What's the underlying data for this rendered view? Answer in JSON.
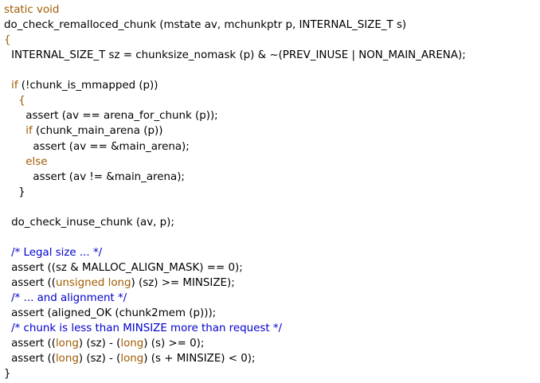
{
  "colors": {
    "text": "#000000",
    "keyword": "#a05a00",
    "comment": "#0000cc",
    "background": "#ffffff"
  },
  "lines": [
    {
      "indent": "",
      "tokens": [
        {
          "text": "static void",
          "type": "keyword"
        }
      ]
    },
    {
      "indent": "",
      "tokens": [
        {
          "text": "do_check_remalloced_chunk (mstate av, mchunkptr p, INTERNAL_SIZE_T s)",
          "type": "plain"
        }
      ]
    },
    {
      "indent": "",
      "tokens": [
        {
          "text": "{",
          "type": "keyword"
        }
      ]
    },
    {
      "indent": "  ",
      "tokens": [
        {
          "text": "INTERNAL_SIZE_T sz = chunksize_nomask (p) & ~(PREV_INUSE | NON_MAIN_ARENA);",
          "type": "plain"
        }
      ]
    },
    {
      "indent": "",
      "tokens": []
    },
    {
      "indent": "  ",
      "tokens": [
        {
          "text": "if",
          "type": "keyword"
        },
        {
          "text": " (!chunk_is_mmapped (p))",
          "type": "plain"
        }
      ]
    },
    {
      "indent": "    ",
      "tokens": [
        {
          "text": "{",
          "type": "keyword"
        }
      ]
    },
    {
      "indent": "      ",
      "tokens": [
        {
          "text": "assert (av == arena_for_chunk (p));",
          "type": "plain"
        }
      ]
    },
    {
      "indent": "      ",
      "tokens": [
        {
          "text": "if",
          "type": "keyword"
        },
        {
          "text": " (chunk_main_arena (p))",
          "type": "plain"
        }
      ]
    },
    {
      "indent": "        ",
      "tokens": [
        {
          "text": "assert (av == &main_arena);",
          "type": "plain"
        }
      ]
    },
    {
      "indent": "      ",
      "tokens": [
        {
          "text": "else",
          "type": "keyword"
        }
      ]
    },
    {
      "indent": "        ",
      "tokens": [
        {
          "text": "assert (av != &main_arena);",
          "type": "plain"
        }
      ]
    },
    {
      "indent": "    ",
      "tokens": [
        {
          "text": "}",
          "type": "plain"
        }
      ]
    },
    {
      "indent": "",
      "tokens": []
    },
    {
      "indent": "  ",
      "tokens": [
        {
          "text": "do_check_inuse_chunk (av, p);",
          "type": "plain"
        }
      ]
    },
    {
      "indent": "",
      "tokens": []
    },
    {
      "indent": "  ",
      "tokens": [
        {
          "text": "/* Legal size ... */",
          "type": "comment"
        }
      ]
    },
    {
      "indent": "  ",
      "tokens": [
        {
          "text": "assert ((sz & MALLOC_ALIGN_MASK) == 0);",
          "type": "plain"
        }
      ]
    },
    {
      "indent": "  ",
      "tokens": [
        {
          "text": "assert ((",
          "type": "plain"
        },
        {
          "text": "unsigned long",
          "type": "keyword"
        },
        {
          "text": ") (sz) >= MINSIZE);",
          "type": "plain"
        }
      ]
    },
    {
      "indent": "  ",
      "tokens": [
        {
          "text": "/* ... and alignment */",
          "type": "comment"
        }
      ]
    },
    {
      "indent": "  ",
      "tokens": [
        {
          "text": "assert (aligned_OK (chunk2mem (p)));",
          "type": "plain"
        }
      ]
    },
    {
      "indent": "  ",
      "tokens": [
        {
          "text": "/* chunk is less than MINSIZE more than request */",
          "type": "comment"
        }
      ]
    },
    {
      "indent": "  ",
      "tokens": [
        {
          "text": "assert ((",
          "type": "plain"
        },
        {
          "text": "long",
          "type": "keyword"
        },
        {
          "text": ") (sz) - (",
          "type": "plain"
        },
        {
          "text": "long",
          "type": "keyword"
        },
        {
          "text": ") (s) >= 0);",
          "type": "plain"
        }
      ]
    },
    {
      "indent": "  ",
      "tokens": [
        {
          "text": "assert ((",
          "type": "plain"
        },
        {
          "text": "long",
          "type": "keyword"
        },
        {
          "text": ") (sz) - (",
          "type": "plain"
        },
        {
          "text": "long",
          "type": "keyword"
        },
        {
          "text": ") (s + MINSIZE) < 0);",
          "type": "plain"
        }
      ]
    },
    {
      "indent": "",
      "tokens": [
        {
          "text": "}",
          "type": "plain"
        }
      ]
    }
  ]
}
